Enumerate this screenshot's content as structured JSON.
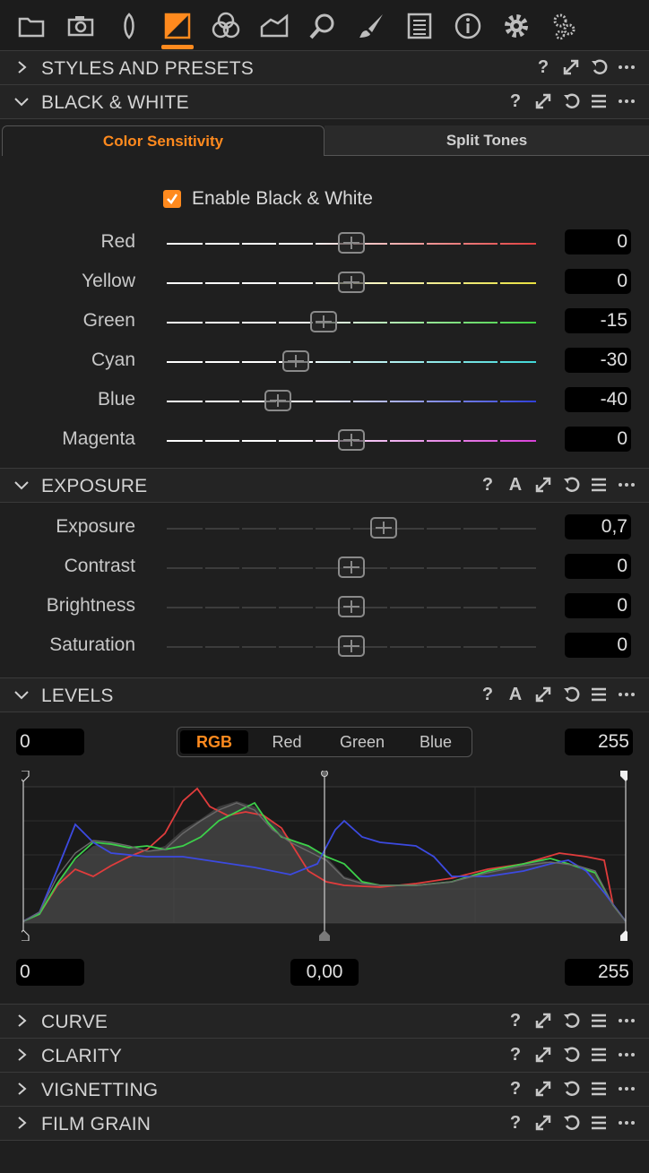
{
  "toolbar": {
    "icons": [
      "folder-icon",
      "camera-icon",
      "lens-icon",
      "exposure-icon",
      "color-icon",
      "details-icon",
      "search-icon",
      "brush-icon",
      "metadata-icon",
      "info-icon",
      "gear-icon",
      "gears-icon"
    ],
    "active_index": 3,
    "accent": "#ff8a1e"
  },
  "sections": {
    "styles": {
      "title": "STYLES AND PRESETS"
    },
    "bw": {
      "title": "BLACK & WHITE"
    },
    "exposure": {
      "title": "EXPOSURE"
    },
    "levels": {
      "title": "LEVELS"
    },
    "curve": {
      "title": "CURVE"
    },
    "clarity": {
      "title": "CLARITY"
    },
    "vignetting": {
      "title": "VIGNETTING"
    },
    "filmgrain": {
      "title": "FILM GRAIN"
    }
  },
  "header_icons": {
    "help": "?",
    "auto": "A"
  },
  "bw_tabs": {
    "active": "Color Sensitivity",
    "inactive": "Split Tones"
  },
  "bw_enable": {
    "label": "Enable Black & White",
    "checked": true
  },
  "bw_sliders": [
    {
      "label": "Red",
      "value": "0",
      "num": 0,
      "color": "#e04040"
    },
    {
      "label": "Yellow",
      "value": "0",
      "num": 0,
      "color": "#e8e040"
    },
    {
      "label": "Green",
      "value": "-15",
      "num": -15,
      "color": "#40d040"
    },
    {
      "label": "Cyan",
      "value": "-30",
      "num": -30,
      "color": "#40d8d8"
    },
    {
      "label": "Blue",
      "value": "-40",
      "num": -40,
      "color": "#3040d8"
    },
    {
      "label": "Magenta",
      "value": "0",
      "num": 0,
      "color": "#d840d8"
    }
  ],
  "exposure_sliders": [
    {
      "label": "Exposure",
      "value": "0,7",
      "num": 0.7
    },
    {
      "label": "Contrast",
      "value": "0",
      "num": 0
    },
    {
      "label": "Brightness",
      "value": "0",
      "num": 0
    },
    {
      "label": "Saturation",
      "value": "0",
      "num": 0
    }
  ],
  "levels": {
    "input_low": "0",
    "input_high": "255",
    "output_low": "0",
    "output_mid": "0,00",
    "output_high": "255",
    "channels": [
      "RGB",
      "Red",
      "Green",
      "Blue"
    ],
    "active_channel": "RGB"
  }
}
